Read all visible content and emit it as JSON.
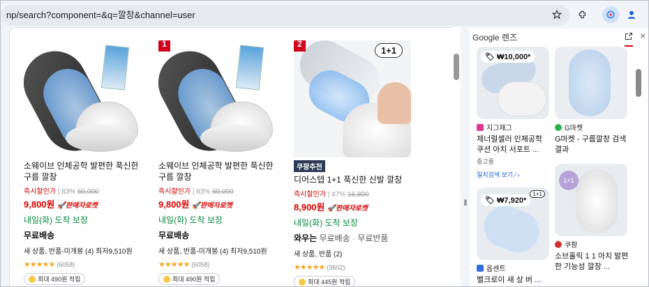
{
  "browser": {
    "url": "np/search?component=&q=깔창&channel=user"
  },
  "products": [
    {
      "badge": "",
      "title": "소웨이브 인체공학 발편한 푹신한 구름 깔창",
      "discount_label": "즉시할인가",
      "discount_pct": "83%",
      "orig_price": "60,000",
      "price": "9,800원",
      "rocket": "판매자로켓",
      "delivery": "내일(화) 도착 보장",
      "shipping": "무료배송",
      "shipping_sub": "",
      "condition": "새 상품, 반품-미개봉 (4) 최저9,510원",
      "stars": "★★★★★",
      "review_count": "(6058)",
      "points": "최대 490원 적립"
    },
    {
      "badge": "1",
      "title": "소웨이브 인체공학 발편한 푹신한 구름 깔창",
      "discount_label": "즉시할인가",
      "discount_pct": "83%",
      "orig_price": "60,000",
      "price": "9,800원",
      "rocket": "판매자로켓",
      "delivery": "내일(화) 도착 보장",
      "shipping": "무료배송",
      "shipping_sub": "",
      "condition": "새 상품, 반품-미개봉 (4) 최저9,510원",
      "stars": "★★★★★",
      "review_count": "(6058)",
      "points": "최대 490원 적립"
    },
    {
      "badge": "2",
      "tag": "쿠팡추천",
      "plus_label": "1+1",
      "title": "디어스텝 1+1 푹신한 신발 깔창",
      "discount_label": "즉시할인가",
      "discount_pct": "47%",
      "orig_price": "16,800",
      "price": "8,900원",
      "rocket": "판매자로켓",
      "delivery": "내일(화) 도착 보장",
      "shipping": "와우는",
      "shipping_sub": "무료배송 · 무료반품",
      "condition": "새 상품, 반품 (2)",
      "stars": "★★★★★",
      "review_count": "(3602)",
      "points": "최대 445원 적립"
    }
  ],
  "lens": {
    "header": "Google 렌즈",
    "results": [
      {
        "price": "₩10,000*",
        "source": "지그재그",
        "source_color": "#e0358d",
        "title": "제너럴셀러 인체공학 쿠션 아치 서포트 ...",
        "sub": "중고품",
        "link": "일치검색 보기 ⁄ ›"
      },
      {
        "price": "",
        "source": "G마켓",
        "source_color": "#2bb24c",
        "title": "G마켓 - 구름깔창 검색결과",
        "sub": "",
        "link": ""
      },
      {
        "price": "₩7,920*",
        "plus_label": "1+1",
        "source": "옵센트",
        "source_color": "#2f6fe0",
        "title": "벨크로이 새 상 버 ...",
        "sub": "",
        "link": ""
      },
      {
        "price": "",
        "plus_label": "1+1",
        "source": "쿠팡",
        "source_color": "#d62f2f",
        "title": "소브홀릭 1 1 아치 발편한 기능성 깔창 ...",
        "sub": "",
        "link": ""
      }
    ]
  }
}
